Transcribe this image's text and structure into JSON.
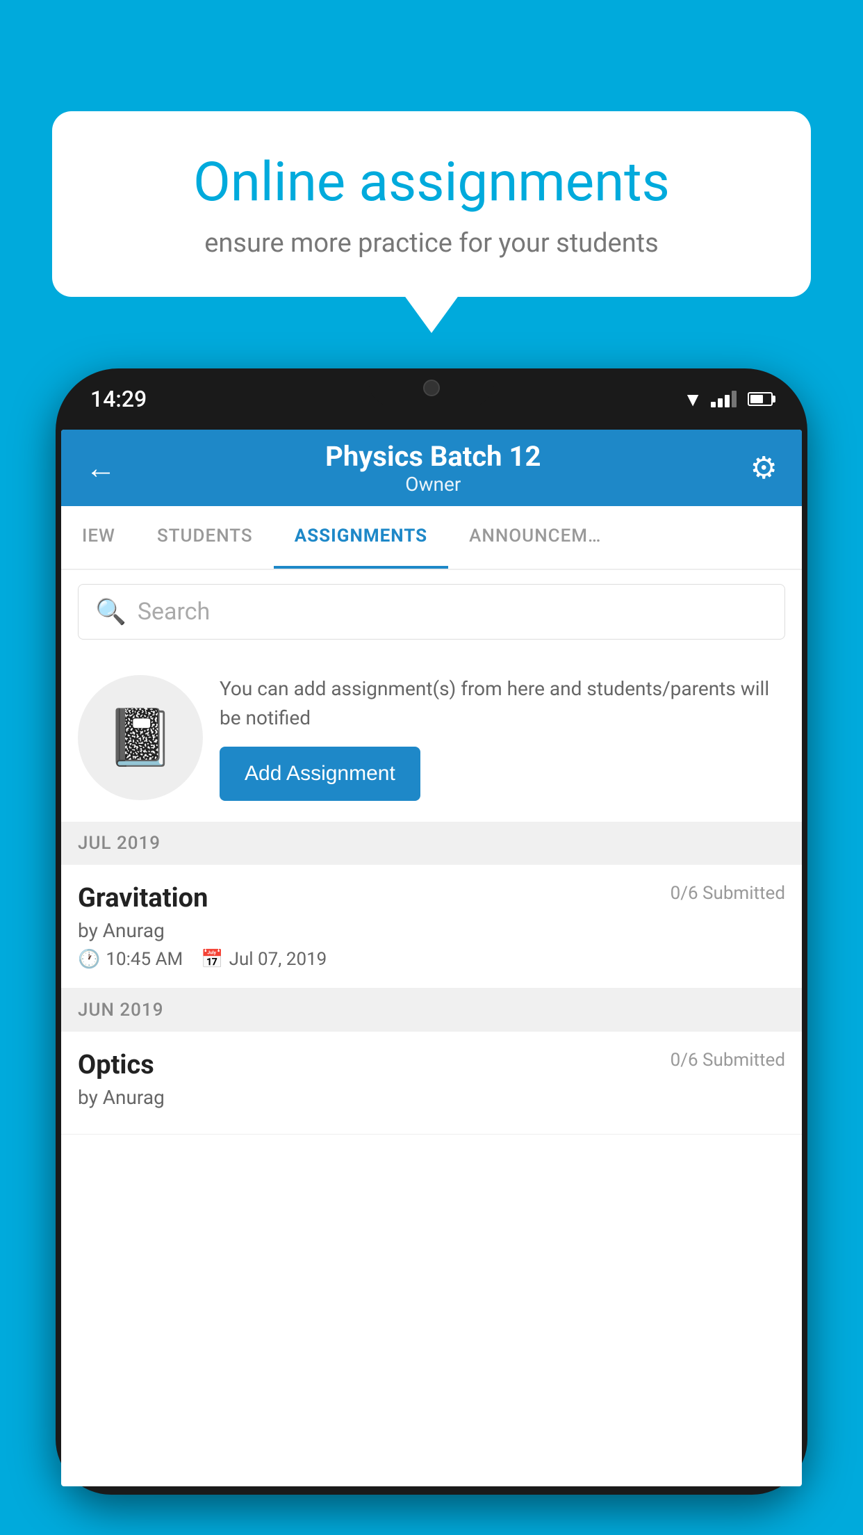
{
  "background_color": "#00AADC",
  "speech_bubble": {
    "title": "Online assignments",
    "subtitle": "ensure more practice for your students"
  },
  "phone": {
    "status_bar": {
      "time": "14:29"
    },
    "header": {
      "title": "Physics Batch 12",
      "subtitle": "Owner",
      "back_label": "←",
      "gear_label": "⚙"
    },
    "tabs": [
      {
        "id": "iew",
        "label": "IEW",
        "active": false
      },
      {
        "id": "students",
        "label": "STUDENTS",
        "active": false
      },
      {
        "id": "assignments",
        "label": "ASSIGNMENTS",
        "active": true
      },
      {
        "id": "announcements",
        "label": "ANNOUNCEMENTS",
        "active": false
      }
    ],
    "search": {
      "placeholder": "Search"
    },
    "promo": {
      "text": "You can add assignment(s) from here and students/parents will be notified",
      "button_label": "Add Assignment"
    },
    "sections": [
      {
        "month_label": "JUL 2019",
        "assignments": [
          {
            "name": "Gravitation",
            "submitted": "0/6 Submitted",
            "author": "by Anurag",
            "time": "10:45 AM",
            "date": "Jul 07, 2019"
          }
        ]
      },
      {
        "month_label": "JUN 2019",
        "assignments": [
          {
            "name": "Optics",
            "submitted": "0/6 Submitted",
            "author": "by Anurag",
            "time": "",
            "date": ""
          }
        ]
      }
    ]
  }
}
